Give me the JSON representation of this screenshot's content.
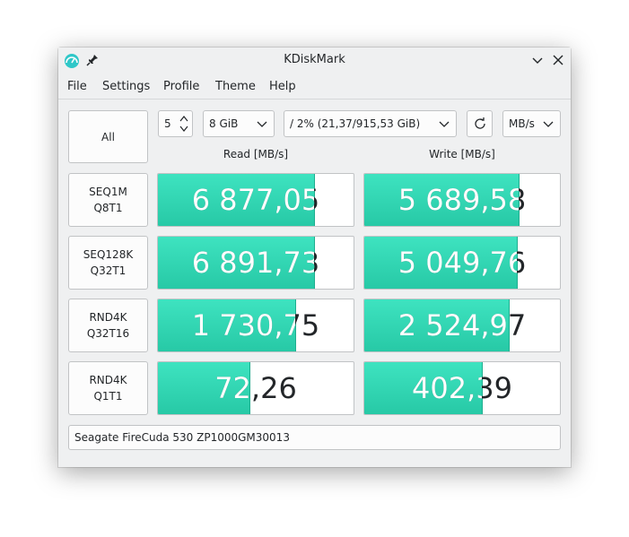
{
  "window": {
    "title": "KDiskMark"
  },
  "menu": [
    "File",
    "Settings",
    "Profile",
    "Theme",
    "Help"
  ],
  "controls": {
    "all_label": "All",
    "loops": "5",
    "size": "8 GiB",
    "target": "/ 2% (21,37/915,53 GiB)",
    "units": "MB/s"
  },
  "columns": {
    "read": "Read [MB/s]",
    "write": "Write [MB/s]"
  },
  "tests": [
    {
      "line1": "SEQ1M",
      "line2": "Q8T1",
      "read": "6 877,05",
      "read_fill": 0.8,
      "write": "5 689,58",
      "write_fill": 0.79
    },
    {
      "line1": "SEQ128K",
      "line2": "Q32T1",
      "read": "6 891,73",
      "read_fill": 0.8,
      "write": "5 049,76",
      "write_fill": 0.78
    },
    {
      "line1": "RND4K",
      "line2": "Q32T16",
      "read": "1 730,75",
      "read_fill": 0.7,
      "write": "2 524,97",
      "write_fill": 0.74
    },
    {
      "line1": "RND4K",
      "line2": "Q1T1",
      "read": "72,26",
      "read_fill": 0.47,
      "write": "402,39",
      "write_fill": 0.6
    }
  ],
  "device": "Seagate FireCuda 530 ZP1000GM30013",
  "colors": {
    "fill_top": "#3ee3c0",
    "fill_bottom": "#27c9a6",
    "window_bg": "#eff0f1"
  }
}
